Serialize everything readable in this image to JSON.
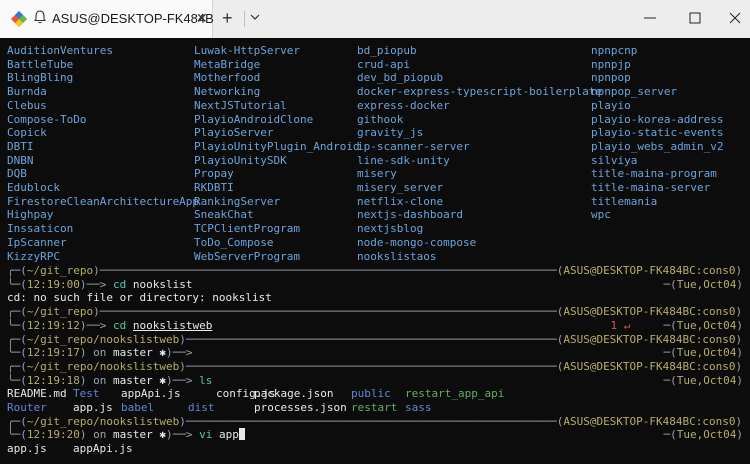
{
  "window": {
    "tab_title": "ASUS@DESKTOP-FK484B",
    "tab_close": "✕",
    "new_tab": "+"
  },
  "listing_columns": [
    [
      "AuditionVentures",
      "BattleTube",
      "BlingBling",
      "Burnda",
      "Clebus",
      "Compose-ToDo",
      "Copick",
      "DBTI",
      "DNBN",
      "DQB",
      "Edublock",
      "FirestoreCleanArchitectureApp",
      "Highpay",
      "Inssaticon",
      "IpScanner",
      "KizzyRPC"
    ],
    [
      "Luwak-HttpServer",
      "MetaBridge",
      "Motherfood",
      "Networking",
      "NextJSTutorial",
      "PlayioAndroidClone",
      "PlayioServer",
      "PlayioUnityPlugin_Android",
      "PlayioUnitySDK",
      "Propay",
      "RKDBTI",
      "RankingServer",
      "SneakChat",
      "TCPClientProgram",
      "ToDo_Compose",
      "WebServerProgram"
    ],
    [
      "bd_piopub",
      "crud-api",
      "dev_bd_piopub",
      "docker-express-typescript-boilerplate",
      "express-docker",
      "githook",
      "gravity_js",
      "ip-scanner-server",
      "line-sdk-unity",
      "misery",
      "misery_server",
      "netflix-clone",
      "nextjs-dashboard",
      "nextjsblog",
      "node-mongo-compose",
      "nookslistaos"
    ],
    [
      "npnpcnp",
      "npnpjp",
      "npnpop",
      "npnpop_server",
      "playio",
      "playio-korea-address",
      "playio-static-events",
      "playio_webs_admin_v2",
      "silviya",
      "title-maina-program",
      "title-maina-server",
      "titlemania",
      "wpc"
    ]
  ],
  "prompts": [
    {
      "path": "~/git_repo",
      "time": "12:19:00",
      "branch": "",
      "command_name": "cd",
      "command_arg": "nookslist",
      "host": "ASUS@DESKTOP-FK484BC:cons0",
      "date": "Tue,Oct04",
      "status": "",
      "output": "cd: no such file or directory: nookslist"
    },
    {
      "path": "~/git_repo",
      "time": "12:19:12",
      "branch": "",
      "command_name": "cd",
      "command_arg": "nookslistweb",
      "host": "ASUS@DESKTOP-FK484BC:cons0",
      "date": "Tue,Oct04",
      "status": "1 ↵",
      "output": ""
    },
    {
      "path": "~/git_repo/nookslistweb",
      "time": "12:19:17",
      "branch": "master ✱",
      "command_name": "",
      "command_arg": "",
      "host": "ASUS@DESKTOP-FK484BC:cons0",
      "date": "Tue,Oct04",
      "status": "",
      "output": ""
    },
    {
      "path": "~/git_repo/nookslistweb",
      "time": "12:19:18",
      "branch": "master ✱",
      "command_name": "ls",
      "command_arg": "",
      "host": "ASUS@DESKTOP-FK484BC:cons0",
      "date": "Tue,Oct04",
      "status": "",
      "output": ""
    },
    {
      "path": "~/git_repo/nookslistweb",
      "time": "12:19:20",
      "branch": "master ✱",
      "command_name": "vi",
      "command_arg": "app",
      "host": "ASUS@DESKTOP-FK484BC:cons0",
      "date": "Tue,Oct04",
      "status": "",
      "output": ""
    }
  ],
  "ls_row1": [
    "README.md",
    "Test",
    "appApi.js",
    "config.js",
    "package.json",
    "public",
    "restart_app_api"
  ],
  "ls_row2": [
    "Router",
    "app.js",
    "babel",
    "dist",
    "processes.json",
    "restart",
    "sass"
  ],
  "completions": [
    "app.js",
    "appApi.js"
  ]
}
